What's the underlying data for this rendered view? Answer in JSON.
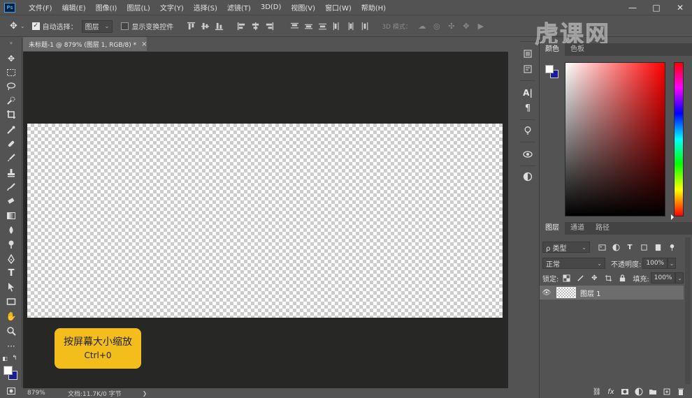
{
  "app": {
    "logo": "Ps"
  },
  "menubar": {
    "items": [
      "文件(F)",
      "编辑(E)",
      "图像(I)",
      "图层(L)",
      "文字(Y)",
      "选择(S)",
      "滤镜(T)",
      "3D(D)",
      "视图(V)",
      "窗口(W)",
      "帮助(H)"
    ],
    "window_buttons": [
      "—",
      "□",
      "✕"
    ]
  },
  "optionsbar": {
    "auto_select_label": "自动选择：",
    "auto_select_checked": true,
    "auto_select_target": "图层",
    "transform_controls_label": "显示变换控件",
    "transform_controls_checked": false,
    "mode_3d_label": "3D 模式："
  },
  "watermark": {
    "text": "虎课网"
  },
  "document": {
    "tab_title": "未标题-1 @ 879% (图层 1, RGB/8) *",
    "close_glyph": "×",
    "canvas_background": "transparent"
  },
  "tip": {
    "title": "按屏幕大小缩放",
    "shortcut": "Ctrl+0"
  },
  "statusbar": {
    "zoom": "879%",
    "doc_info": "文档:11.7K/0 字节",
    "arrow": "❯"
  },
  "colors": {
    "foreground": "#ffffff",
    "background": "#1a1c9c",
    "tip_bg": "#f3bd1c"
  },
  "color_panel": {
    "tabs": [
      "颜色",
      "色板"
    ],
    "active_tab": 0
  },
  "layers_panel": {
    "tabs": [
      "图层",
      "通道",
      "路径"
    ],
    "active_tab": 0,
    "filter_label": "ρ 类型",
    "blend_mode": "正常",
    "opacity_label": "不透明度:",
    "opacity_value": "100%",
    "lock_label": "锁定:",
    "fill_label": "填充:",
    "fill_value": "100%",
    "layers": [
      {
        "name": "图层 1",
        "visible": true,
        "selected": true
      }
    ]
  }
}
